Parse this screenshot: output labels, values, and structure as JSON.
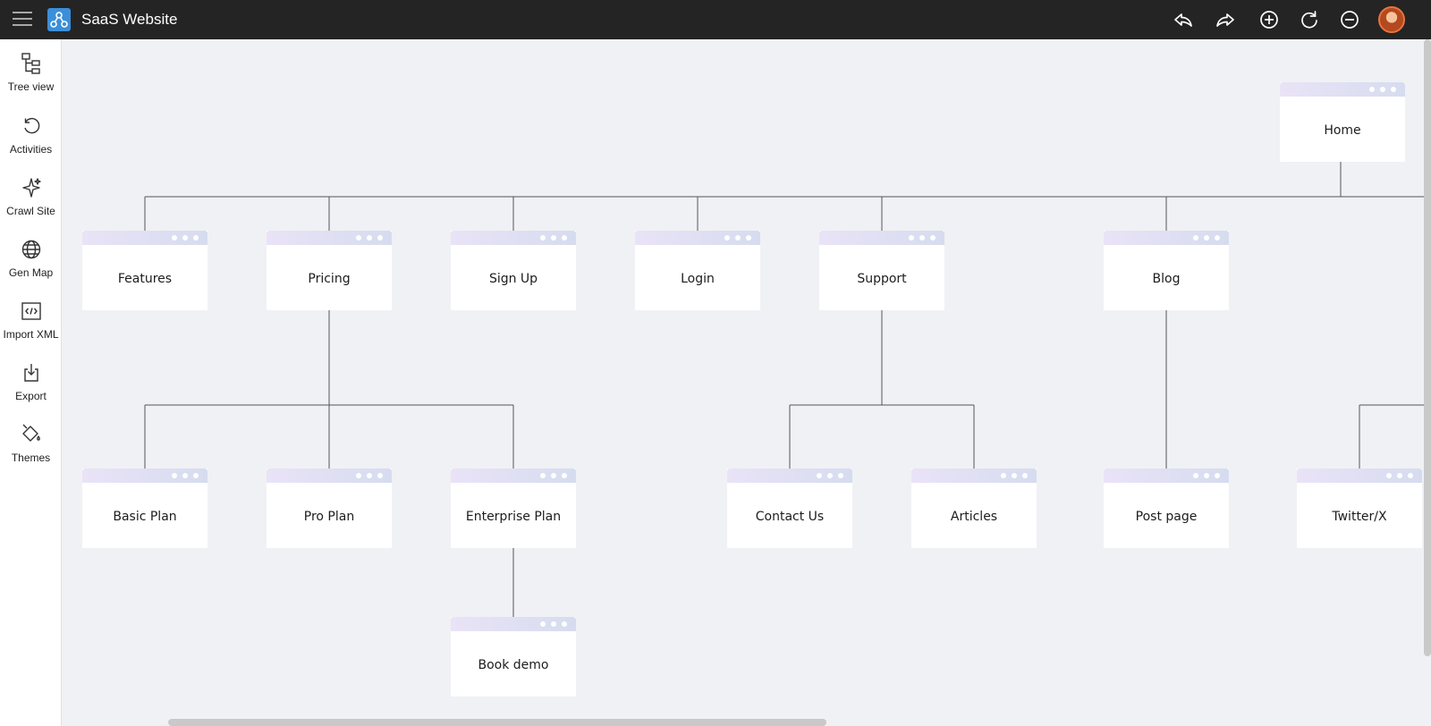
{
  "header": {
    "title": "SaaS Website",
    "actions": [
      {
        "name": "undo-icon"
      },
      {
        "name": "redo-icon"
      },
      {
        "name": "add-icon"
      },
      {
        "name": "refresh-icon"
      },
      {
        "name": "remove-icon"
      }
    ]
  },
  "sidebar": {
    "items": [
      {
        "label": "Tree view",
        "icon": "tree-view-icon"
      },
      {
        "label": "Activities",
        "icon": "history-icon"
      },
      {
        "label": "Crawl Site",
        "icon": "sparkle-icon"
      },
      {
        "label": "Gen Map",
        "icon": "globe-icon"
      },
      {
        "label": "Import XML",
        "icon": "code-icon"
      },
      {
        "label": "Export",
        "icon": "download-icon"
      },
      {
        "label": "Themes",
        "icon": "paint-bucket-icon"
      }
    ]
  },
  "sitemap": {
    "root": "Home",
    "level1": [
      "Features",
      "Pricing",
      "Sign Up",
      "Login",
      "Support",
      "Blog"
    ],
    "pricing_children": [
      "Basic Plan",
      "Pro Plan",
      "Enterprise Plan"
    ],
    "enterprise_children": [
      "Book demo"
    ],
    "support_children": [
      "Contact Us",
      "Articles"
    ],
    "blog_children": [
      "Post page"
    ],
    "offscreen_children": [
      "Twitter/X"
    ]
  },
  "colors": {
    "topbar": "#242424",
    "canvas": "#f0f1f5",
    "accent": "#3b8fd9"
  }
}
